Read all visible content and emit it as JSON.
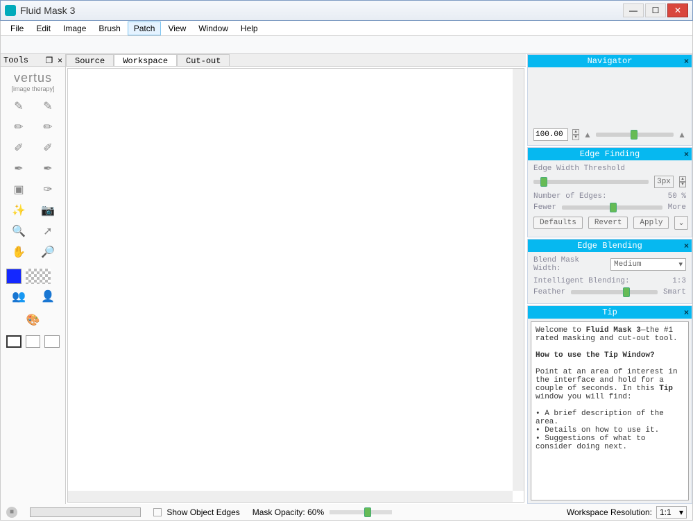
{
  "window": {
    "title": "Fluid Mask 3"
  },
  "menu": [
    "File",
    "Edit",
    "Image",
    "Brush",
    "Patch",
    "View",
    "Window",
    "Help"
  ],
  "menu_highlight_index": 4,
  "tools": {
    "header": "Tools",
    "logo": "vertus",
    "logo_sub": "[image therapy]",
    "icons": [
      "brush-icon-1",
      "brush-icon-2",
      "brush-icon-3",
      "brush-icon-4",
      "brush-icon-5",
      "brush-icon-6",
      "brush-icon-7",
      "brush-icon-8",
      "marquee-icon",
      "pen-icon",
      "wand-icon",
      "camera-icon",
      "loupe-icon",
      "arrow-icon",
      "hand-icon",
      "zoom-icon"
    ]
  },
  "tabs": {
    "items": [
      "Source",
      "Workspace",
      "Cut-out"
    ],
    "active_index": 1
  },
  "panels": {
    "navigator": {
      "title": "Navigator",
      "zoom": "100.00"
    },
    "edge_finding": {
      "title": "Edge Finding",
      "threshold_label": "Edge Width Threshold",
      "px_value": "3px",
      "edges_label": "Number of Edges:",
      "edges_value": "50 %",
      "fewer": "Fewer",
      "more": "More",
      "buttons": {
        "defaults": "Defaults",
        "revert": "Revert",
        "apply": "Apply"
      }
    },
    "edge_blending": {
      "title": "Edge Blending",
      "width_label": "Blend Mask Width:",
      "width_value": "Medium",
      "intel_label": "Intelligent Blending:",
      "intel_value": "1:3",
      "feather": "Feather",
      "smart": "Smart"
    },
    "tip": {
      "title": "Tip",
      "text_pre": "Welcome to ",
      "text_bold1": "Fluid Mask 3",
      "text_post1": "—the #1 rated masking and cut-out tool.",
      "howto": "How to use the Tip Window?",
      "para": "Point at an area of interest in the interface and hold for a couple of seconds. In this ",
      "para_bold": "Tip",
      "para_post": " window you will find:",
      "b1": "• A brief description of the area.",
      "b2": "• Details on how to use it.",
      "b3": "• Suggestions of what to consider doing next."
    }
  },
  "status": {
    "show_edges": "Show Object Edges",
    "opacity_label": "Mask Opacity: 60%",
    "res_label": "Workspace Resolution:",
    "res_value": "1:1"
  }
}
